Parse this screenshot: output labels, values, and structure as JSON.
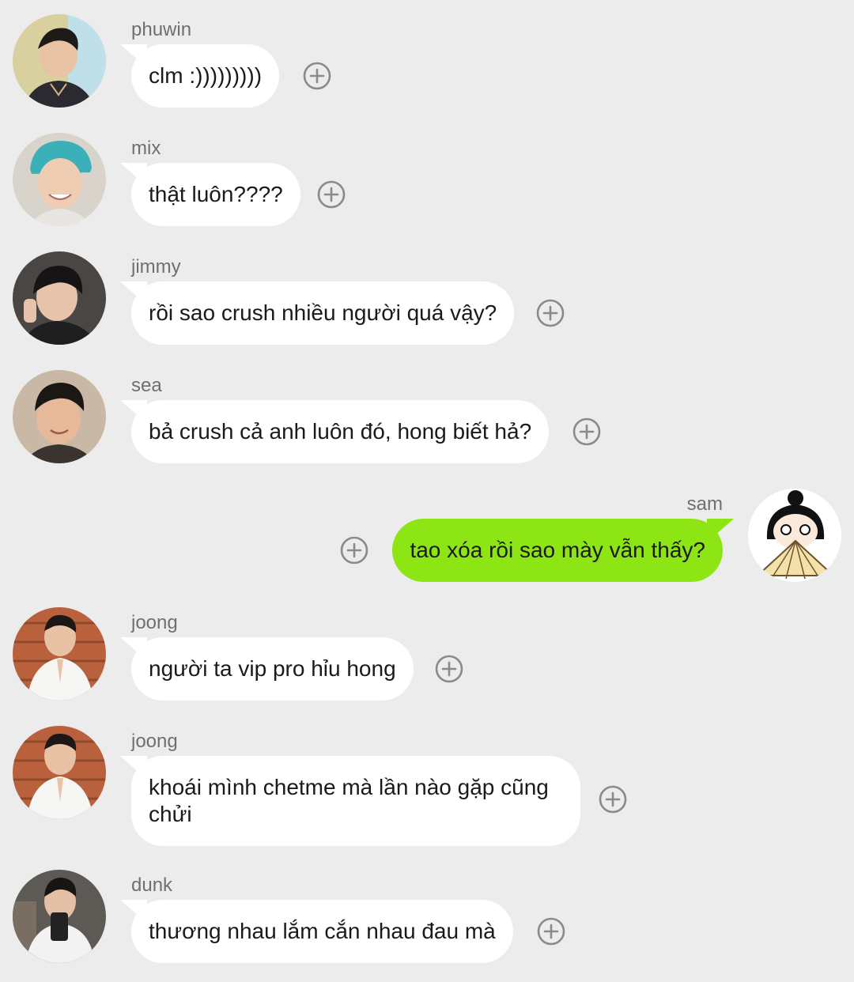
{
  "messages": [
    {
      "sender": "phuwin",
      "text": "clm :)))))))))",
      "side": "left",
      "avatar": "avatar-phuwin"
    },
    {
      "sender": "mix",
      "text": "thật luôn????",
      "side": "left",
      "avatar": "avatar-mix"
    },
    {
      "sender": "jimmy",
      "text": "rồi sao crush nhiều người quá vậy?",
      "side": "left",
      "avatar": "avatar-jimmy"
    },
    {
      "sender": "sea",
      "text": "bả crush cả anh luôn đó, hong biết hả?",
      "side": "left",
      "avatar": "avatar-sea"
    },
    {
      "sender": "sam",
      "text": "tao xóa rồi sao mày vẫn thấy?",
      "side": "right",
      "avatar": "avatar-sam"
    },
    {
      "sender": "joong",
      "text": "người ta vip pro hỉu hong",
      "side": "left",
      "avatar": "avatar-joong"
    },
    {
      "sender": "joong",
      "text": "khoái mình chetme mà lần nào gặp cũng chửi",
      "side": "left",
      "avatar": "avatar-joong"
    },
    {
      "sender": "dunk",
      "text": "thương nhau lắm cắn nhau đau mà",
      "side": "left",
      "avatar": "avatar-dunk"
    }
  ],
  "icons": {
    "reaction": "plus-circle-icon"
  },
  "colors": {
    "background": "#ececec",
    "bubble_incoming": "#ffffff",
    "bubble_outgoing": "#8de514",
    "sender_text": "#6f6f6f",
    "plus_icon": "#8a8a8a"
  }
}
